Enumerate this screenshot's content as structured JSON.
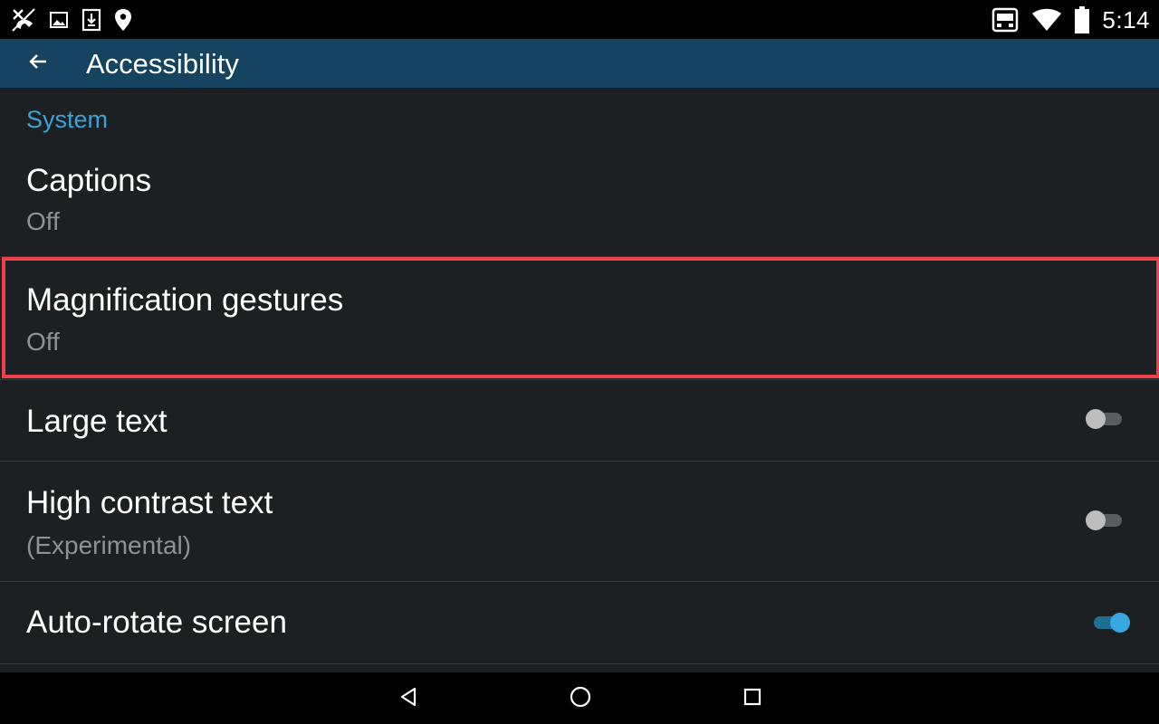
{
  "status_bar": {
    "time": "5:14",
    "left_icons": [
      "missed-call-icon",
      "image-icon",
      "download-icon",
      "location-icon"
    ],
    "right_icons": [
      "cast-icon",
      "wifi-icon",
      "battery-icon"
    ]
  },
  "toolbar": {
    "title": "Accessibility"
  },
  "section": {
    "header": "System"
  },
  "items": [
    {
      "title": "Captions",
      "summary": "Off"
    },
    {
      "title": "Magnification gestures",
      "summary": "Off"
    },
    {
      "title": "Large text",
      "toggle": "off"
    },
    {
      "title": "High contrast text",
      "summary": "(Experimental)",
      "toggle": "off"
    },
    {
      "title": "Auto-rotate screen",
      "toggle": "on"
    }
  ],
  "colors": {
    "background": "#1d2023",
    "toolbar": "#16435f",
    "accent": "#3aa2d6",
    "highlight": "#f0404a"
  },
  "nav_bar": {
    "buttons": [
      "back-icon",
      "home-icon",
      "recents-icon"
    ]
  }
}
